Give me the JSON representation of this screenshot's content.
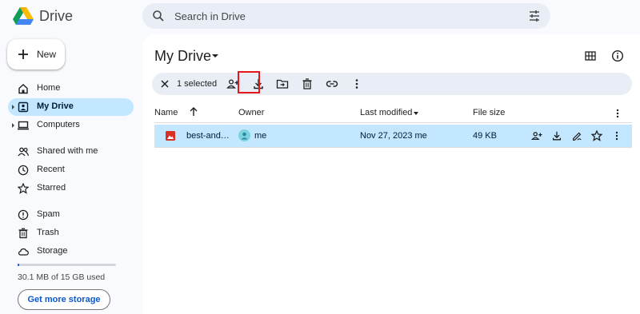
{
  "app": {
    "name": "Drive"
  },
  "search": {
    "placeholder": "Search in Drive"
  },
  "sidebar": {
    "new_label": "New",
    "items": [
      {
        "label": "Home"
      },
      {
        "label": "My Drive"
      },
      {
        "label": "Computers"
      },
      {
        "label": "Shared with me"
      },
      {
        "label": "Recent"
      },
      {
        "label": "Starred"
      },
      {
        "label": "Spam"
      },
      {
        "label": "Trash"
      },
      {
        "label": "Storage"
      }
    ],
    "storage": {
      "used_text": "30.1 MB of 15 GB used",
      "used_fraction": 0.002,
      "button_label": "Get more storage"
    }
  },
  "main": {
    "title": "My Drive",
    "selection": {
      "count_text": "1 selected"
    },
    "columns": {
      "name": "Name",
      "owner": "Owner",
      "modified": "Last modified",
      "size": "File size"
    },
    "files": [
      {
        "name": "best-and…",
        "owner": "me",
        "modified": "Nov 27, 2023 me",
        "size": "49 KB"
      }
    ]
  },
  "colors": {
    "accent": "#0b57d0",
    "selected_row": "#c2e7ff",
    "highlight": "#e4181c",
    "action_bar": "#e9eef6"
  },
  "icons": {
    "header": [
      "drive-logo-icon",
      "search-icon",
      "tune-icon"
    ],
    "action_bar": [
      "close-icon",
      "share-icon",
      "download-icon",
      "move-icon",
      "trash-icon",
      "link-icon",
      "more-vert-icon"
    ],
    "row": [
      "image-file-icon",
      "share-icon",
      "download-icon",
      "rename-icon",
      "star-icon",
      "more-vert-icon"
    ]
  }
}
